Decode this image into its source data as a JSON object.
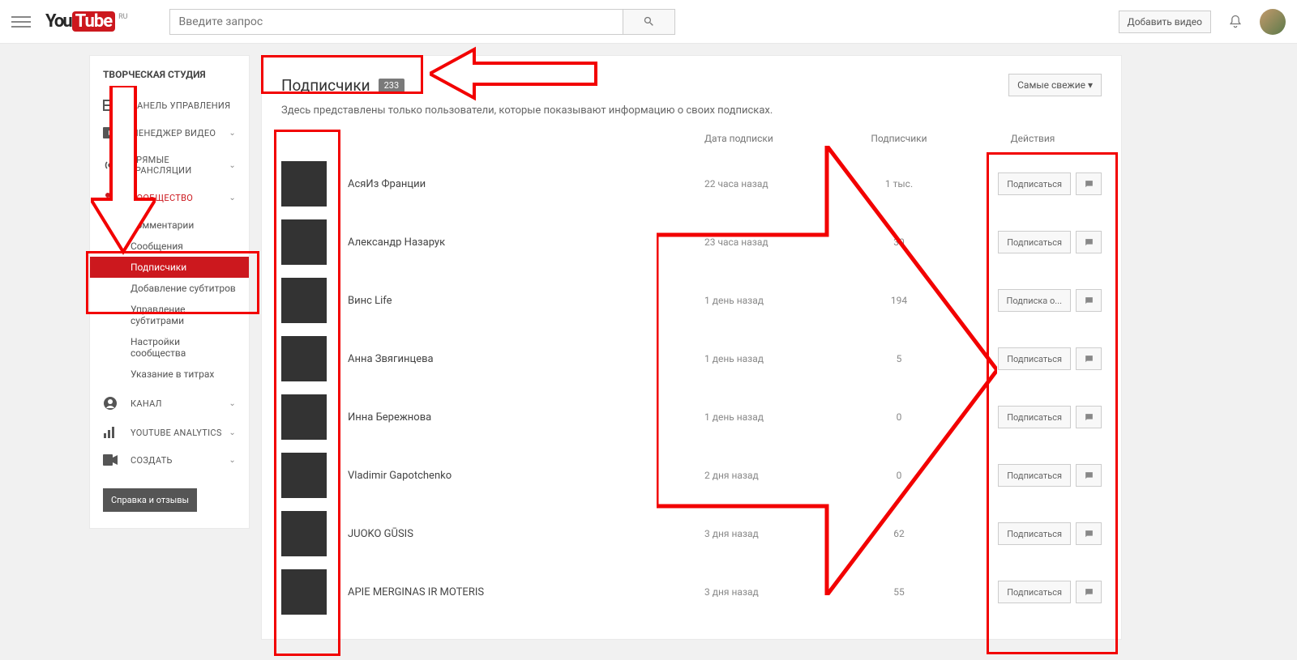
{
  "header": {
    "logo_left": "You",
    "logo_right": "Tube",
    "country": "RU",
    "search_placeholder": "Введите запрос",
    "upload_label": "Добавить видео"
  },
  "sidebar": {
    "title": "ТВОРЧЕСКАЯ СТУДИЯ",
    "items": [
      {
        "label": "ПАНЕЛЬ УПРАВЛЕНИЯ"
      },
      {
        "label": "МЕНЕДЖЕР ВИДЕО",
        "chevron": true
      },
      {
        "label": "ПРЯМЫЕ ТРАНСЛЯЦИИ",
        "chevron": true
      },
      {
        "label": "СООБЩЕСТВО",
        "chevron": true,
        "active": true
      },
      {
        "label": "КАНАЛ",
        "chevron": true
      },
      {
        "label": "YOUTUBE ANALYTICS",
        "chevron": true
      },
      {
        "label": "СОЗДАТЬ",
        "chevron": true
      }
    ],
    "community": [
      "Комментарии",
      "Сообщения",
      "Подписчики",
      "Добавление субтитров",
      "Управление субтитрами",
      "Настройки сообщества",
      "Указание в титрах"
    ],
    "help": "Справка и отзывы"
  },
  "main": {
    "title": "Подписчики",
    "count": "233",
    "sort_label": "Самые свежие ▾",
    "subtitle": "Здесь представлены только пользователи, которые показывают информацию о своих подписках.",
    "col_date": "Дата подписки",
    "col_subs": "Подписчики",
    "col_actions": "Действия",
    "subscribe_label": "Подписаться",
    "rows": [
      {
        "name": "АсяИз Франции",
        "date": "22 часа назад",
        "subs": "1 тыс.",
        "action": "Подписаться"
      },
      {
        "name": "Александр Назарук",
        "date": "23 часа назад",
        "subs": "30",
        "action": "Подписаться"
      },
      {
        "name": "Винс Life",
        "date": "1 день назад",
        "subs": "194",
        "action": "Подписка о..."
      },
      {
        "name": "Анна Звягинцева",
        "date": "1 день назад",
        "subs": "5",
        "action": "Подписаться"
      },
      {
        "name": "Инна Бережнова",
        "date": "1 день назад",
        "subs": "0",
        "action": "Подписаться"
      },
      {
        "name": "Vladimir Gapotchenko",
        "date": "2 дня назад",
        "subs": "0",
        "action": "Подписаться"
      },
      {
        "name": "JUOKO GŪSIS",
        "date": "3 дня назад",
        "subs": "62",
        "action": "Подписаться"
      },
      {
        "name": "APIE MERGINAS IR MOTERIS",
        "date": "3 дня назад",
        "subs": "55",
        "action": "Подписаться"
      }
    ]
  }
}
